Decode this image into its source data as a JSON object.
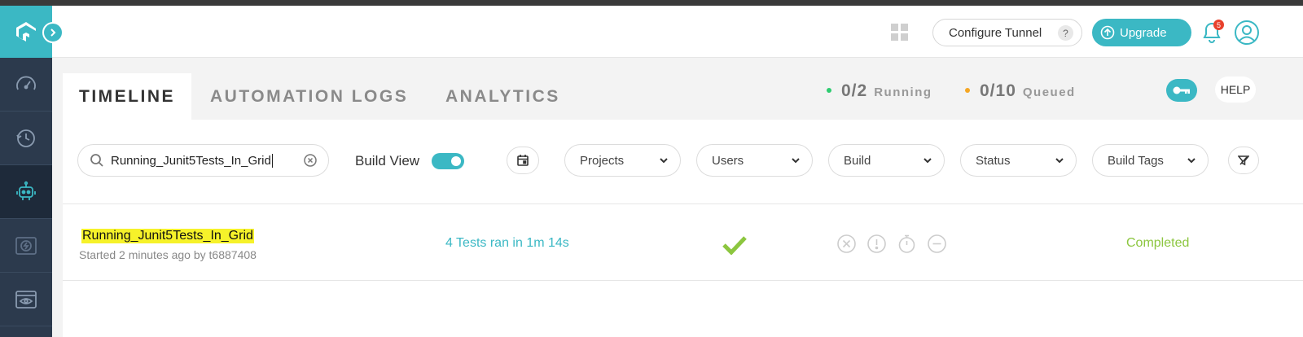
{
  "header": {
    "configure_tunnel": "Configure Tunnel",
    "help_q": "?",
    "upgrade": "Upgrade",
    "notification_count": "5"
  },
  "tabs": {
    "timeline": "TIMELINE",
    "automation_logs": "AUTOMATION LOGS",
    "analytics": "ANALYTICS"
  },
  "stats": {
    "running_count": "0/2",
    "running_label": "Running",
    "queued_count": "0/10",
    "queued_label": "Queued",
    "help": "HELP"
  },
  "filters": {
    "search_value": "Running_Junit5Tests_In_Grid",
    "build_view_label": "Build View",
    "build_view_on": true,
    "dropdowns": [
      "Projects",
      "Users",
      "Build",
      "Status",
      "Build Tags"
    ]
  },
  "builds": [
    {
      "name": "Running_Junit5Tests_In_Grid",
      "meta": "Started 2 minutes ago by t6887408",
      "tests_summary": "4 Tests ran in 1m 14s",
      "status": "Completed"
    }
  ],
  "colors": {
    "accent": "#3bb8c4",
    "sidebar": "#2c3a4d",
    "success": "#8cc63f",
    "running_dot": "#2ecc71",
    "queued_dot": "#f5a623",
    "highlight": "#f6f22a"
  },
  "icons": {
    "sidebar": [
      "dashboard-gauge-icon",
      "history-clock-icon",
      "automation-robot-icon",
      "realtime-bolt-icon",
      "visual-eye-icon"
    ]
  }
}
